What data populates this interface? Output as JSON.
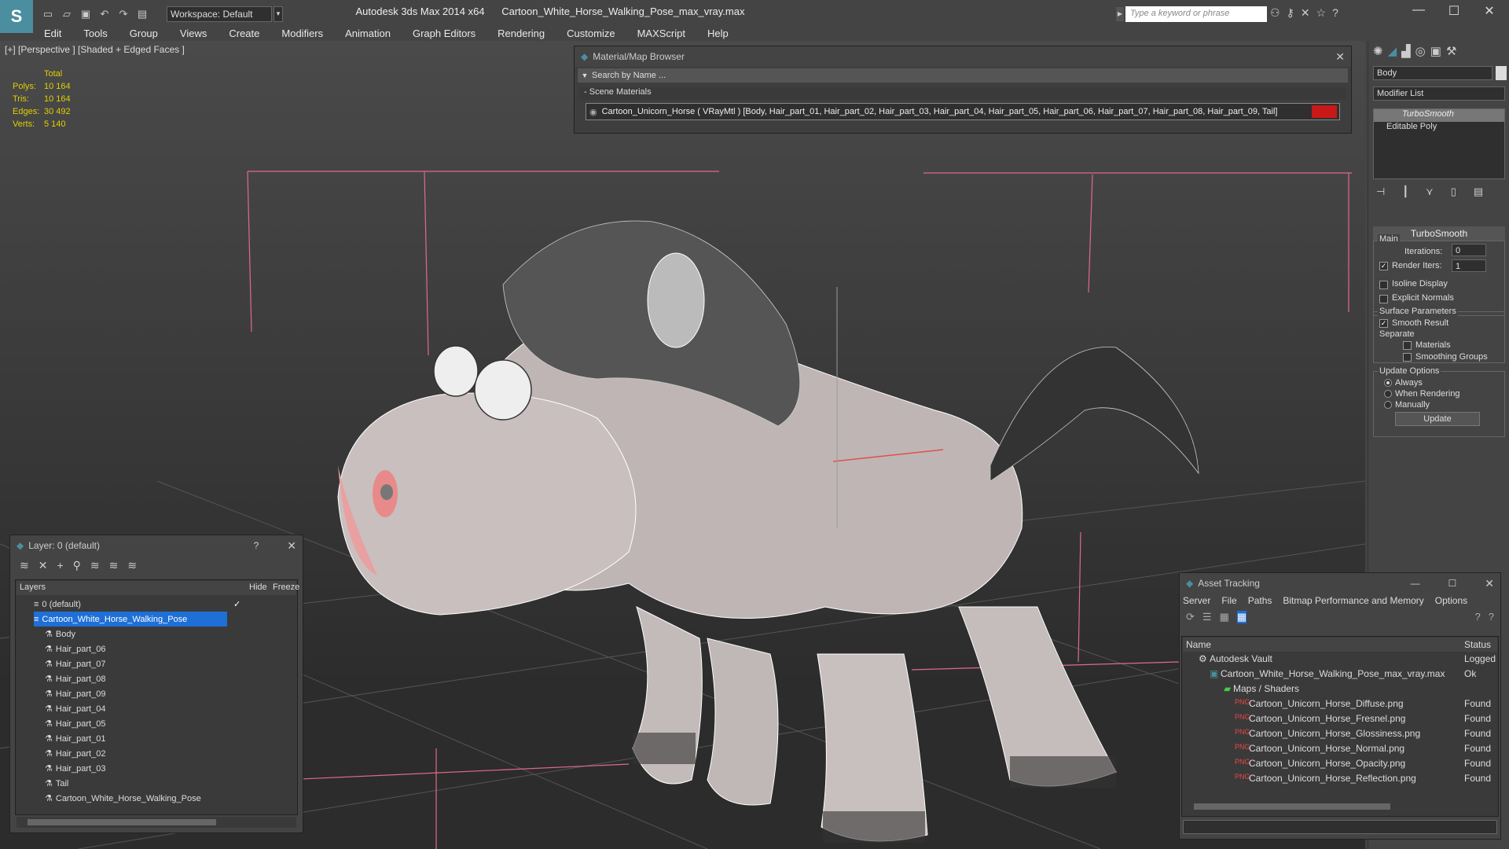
{
  "title": {
    "app": "Autodesk 3ds Max  2014 x64",
    "file": "Cartoon_White_Horse_Walking_Pose_max_vray.max",
    "workspace": "Workspace: Default",
    "search_placeholder": "Type a keyword or phrase"
  },
  "menu": [
    "Edit",
    "Tools",
    "Group",
    "Views",
    "Create",
    "Modifiers",
    "Animation",
    "Graph Editors",
    "Rendering",
    "Customize",
    "MAXScript",
    "Help"
  ],
  "viewport": {
    "label": "[+] [Perspective ] [Shaded + Edged Faces ]",
    "stats_header": "Total",
    "stats": [
      {
        "label": "Polys:",
        "value": "10 164"
      },
      {
        "label": "Tris:",
        "value": "10 164"
      },
      {
        "label": "Edges:",
        "value": "30 492"
      },
      {
        "label": "Verts:",
        "value": "5 140"
      }
    ]
  },
  "material_browser": {
    "title": "Material/Map Browser",
    "search": "Search by Name ...",
    "section": "Scene Materials",
    "material": "Cartoon_Unicorn_Horse  ( VRayMtl )  [Body, Hair_part_01, Hair_part_02, Hair_part_03, Hair_part_04, Hair_part_05, Hair_part_06, Hair_part_07, Hair_part_08, Hair_part_09, Tail]",
    "swatch_color": "#c81818"
  },
  "command_panel": {
    "object_name": "Body",
    "modifier_list": "Modifier List",
    "stack": [
      "TurboSmooth",
      "Editable Poly"
    ],
    "rollout": "TurboSmooth",
    "main_group": "Main",
    "iterations_label": "Iterations:",
    "iterations_value": "0",
    "render_iters_label": "Render Iters:",
    "render_iters_value": "1",
    "isoline": "Isoline Display",
    "explicit": "Explicit Normals",
    "surface_group": "Surface Parameters",
    "smooth_result": "Smooth Result",
    "separate": "Separate",
    "materials": "Materials",
    "smoothing_groups": "Smoothing Groups",
    "update_group": "Update Options",
    "always": "Always",
    "when_rendering": "When Rendering",
    "manually": "Manually",
    "update_button": "Update"
  },
  "layer_panel": {
    "title": "Layer: 0 (default)",
    "help": "?",
    "col_layers": "Layers",
    "col_hide": "Hide",
    "col_freeze": "Freeze",
    "rows": [
      "0 (default)",
      "Cartoon_White_Horse_Walking_Pose",
      "Body",
      "Hair_part_06",
      "Hair_part_07",
      "Hair_part_08",
      "Hair_part_09",
      "Hair_part_04",
      "Hair_part_05",
      "Hair_part_01",
      "Hair_part_02",
      "Hair_part_03",
      "Tail",
      "Cartoon_White_Horse_Walking_Pose"
    ]
  },
  "asset_panel": {
    "title": "Asset Tracking",
    "menu": [
      "Server",
      "File",
      "Paths",
      "Bitmap Performance and Memory",
      "Options"
    ],
    "col_name": "Name",
    "col_status": "Status",
    "rows": [
      {
        "name": "Autodesk Vault",
        "status": "Logged"
      },
      {
        "name": "Cartoon_White_Horse_Walking_Pose_max_vray.max",
        "status": "Ok"
      },
      {
        "name": "Maps / Shaders",
        "status": ""
      },
      {
        "name": "Cartoon_Unicorn_Horse_Diffuse.png",
        "status": "Found"
      },
      {
        "name": "Cartoon_Unicorn_Horse_Fresnel.png",
        "status": "Found"
      },
      {
        "name": "Cartoon_Unicorn_Horse_Glossiness.png",
        "status": "Found"
      },
      {
        "name": "Cartoon_Unicorn_Horse_Normal.png",
        "status": "Found"
      },
      {
        "name": "Cartoon_Unicorn_Horse_Opacity.png",
        "status": "Found"
      },
      {
        "name": "Cartoon_Unicorn_Horse_Reflection.png",
        "status": "Found"
      }
    ]
  },
  "colors": {
    "accent": "#4a8ea0",
    "selection": "#1e6fd6",
    "stats": "#e0d000"
  }
}
